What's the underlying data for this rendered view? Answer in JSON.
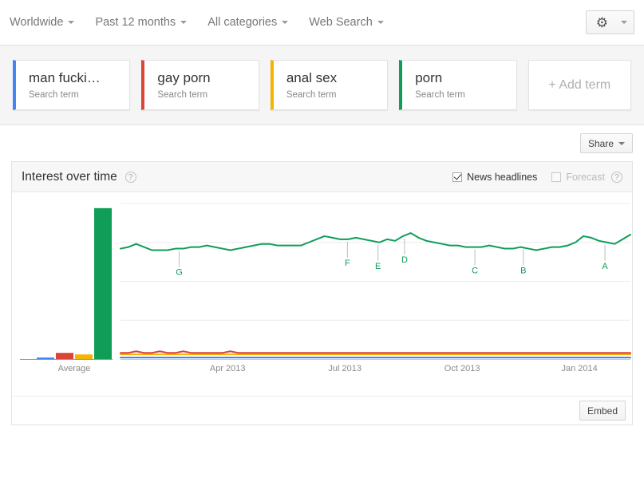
{
  "topbar": {
    "filters": [
      {
        "label": "Worldwide",
        "icon": "chevron-down-icon"
      },
      {
        "label": "Past 12 months",
        "icon": "chevron-down-icon"
      },
      {
        "label": "All categories",
        "icon": "chevron-down-icon"
      },
      {
        "label": "Web Search",
        "icon": "chevron-down-icon"
      }
    ],
    "settings": {
      "icon": "gear-icon",
      "glyph": "⚙",
      "caret": "chevron-down-icon"
    }
  },
  "terms": {
    "subtitle": "Search term",
    "items": [
      {
        "label": "man fucki…",
        "sub": "Search term",
        "color": "#4285F4"
      },
      {
        "label": "gay porn",
        "sub": "Search term",
        "color": "#DB4437"
      },
      {
        "label": "anal sex",
        "sub": "Search term",
        "color": "#F4B400"
      },
      {
        "label": "porn",
        "sub": "Search term",
        "color": "#0F9D58"
      }
    ],
    "add_label": "+ Add term"
  },
  "share": {
    "label": "Share",
    "caret": "chevron-down-icon"
  },
  "module": {
    "title": "Interest over time",
    "help": "?",
    "news_headlines": {
      "label": "News headlines",
      "checked": true
    },
    "forecast": {
      "label": "Forecast",
      "checked": false,
      "disabled": true
    },
    "forecast_help": "?",
    "embed_label": "Embed"
  },
  "chart_data": {
    "type": "line",
    "title": "Interest over time",
    "xlabel": "",
    "ylabel": "",
    "ylim": [
      0,
      100
    ],
    "grid": true,
    "legend_position": "none",
    "average_panel": {
      "label": "Average",
      "type": "bar",
      "categories": [
        "man fucki…",
        "gay porn",
        "anal sex",
        "porn"
      ],
      "values": [
        1,
        4,
        3,
        97
      ],
      "colors": [
        "#4285F4",
        "#DB4437",
        "#F4B400",
        "#0F9D58"
      ]
    },
    "xtick_labels": [
      "Apr 2013",
      "Jul 2013",
      "Oct 2013",
      "Jan 2014"
    ],
    "xtick_positions": [
      0.21,
      0.44,
      0.67,
      0.9
    ],
    "annotations": [
      {
        "label": "G",
        "x": 0.115
      },
      {
        "label": "F",
        "x": 0.445
      },
      {
        "label": "E",
        "x": 0.505
      },
      {
        "label": "D",
        "x": 0.557
      },
      {
        "label": "C",
        "x": 0.695
      },
      {
        "label": "B",
        "x": 0.79
      },
      {
        "label": "A",
        "x": 0.95
      }
    ],
    "series": [
      {
        "name": "porn",
        "color": "#0F9D58",
        "values": [
          71,
          72,
          74,
          72,
          70,
          70,
          70,
          71,
          71,
          72,
          72,
          73,
          72,
          71,
          70,
          71,
          72,
          73,
          74,
          74,
          73,
          73,
          73,
          73,
          75,
          77,
          79,
          78,
          77,
          77,
          78,
          77,
          76,
          75,
          77,
          76,
          79,
          81,
          78,
          76,
          75,
          74,
          73,
          73,
          72,
          72,
          72,
          73,
          72,
          71,
          71,
          72,
          71,
          70,
          71,
          72,
          72,
          73,
          75,
          79,
          78,
          76,
          75,
          74,
          77,
          80
        ]
      },
      {
        "name": "gay porn",
        "color": "#DB4437",
        "values": [
          4,
          4,
          5,
          4,
          4,
          5,
          4,
          4,
          5,
          4,
          4,
          4,
          4,
          4,
          5,
          4,
          4,
          4,
          4,
          4,
          4,
          4,
          4,
          4,
          4,
          4,
          4,
          4,
          4,
          4,
          4,
          4,
          4,
          4,
          4,
          4,
          4,
          4,
          4,
          4,
          4,
          4,
          4,
          4,
          4,
          4,
          4,
          4,
          4,
          4,
          4,
          4,
          4,
          4,
          4,
          4,
          4,
          4,
          4,
          4,
          4,
          4,
          4,
          4,
          4,
          4
        ]
      },
      {
        "name": "anal sex",
        "color": "#F4B400",
        "values": [
          3,
          3,
          3,
          3,
          3,
          3,
          3,
          3,
          3,
          3,
          3,
          3,
          3,
          3,
          3,
          3,
          3,
          3,
          3,
          3,
          3,
          3,
          3,
          3,
          3,
          3,
          3,
          3,
          3,
          3,
          3,
          3,
          3,
          3,
          3,
          3,
          3,
          3,
          3,
          3,
          3,
          3,
          3,
          3,
          3,
          3,
          3,
          3,
          3,
          3,
          3,
          3,
          3,
          3,
          3,
          3,
          3,
          3,
          3,
          3,
          3,
          3,
          3,
          3,
          3,
          3
        ]
      },
      {
        "name": "man fucki…",
        "color": "#4285F4",
        "values": [
          1,
          1,
          1,
          1,
          1,
          1,
          1,
          1,
          1,
          1,
          1,
          1,
          1,
          1,
          1,
          1,
          1,
          1,
          1,
          1,
          1,
          1,
          1,
          1,
          1,
          1,
          1,
          1,
          1,
          1,
          1,
          1,
          1,
          1,
          1,
          1,
          1,
          1,
          1,
          1,
          1,
          1,
          1,
          1,
          1,
          1,
          1,
          1,
          1,
          1,
          1,
          1,
          1,
          1,
          1,
          1,
          1,
          1,
          1,
          1,
          1,
          1,
          1,
          1,
          1,
          1
        ]
      }
    ]
  }
}
